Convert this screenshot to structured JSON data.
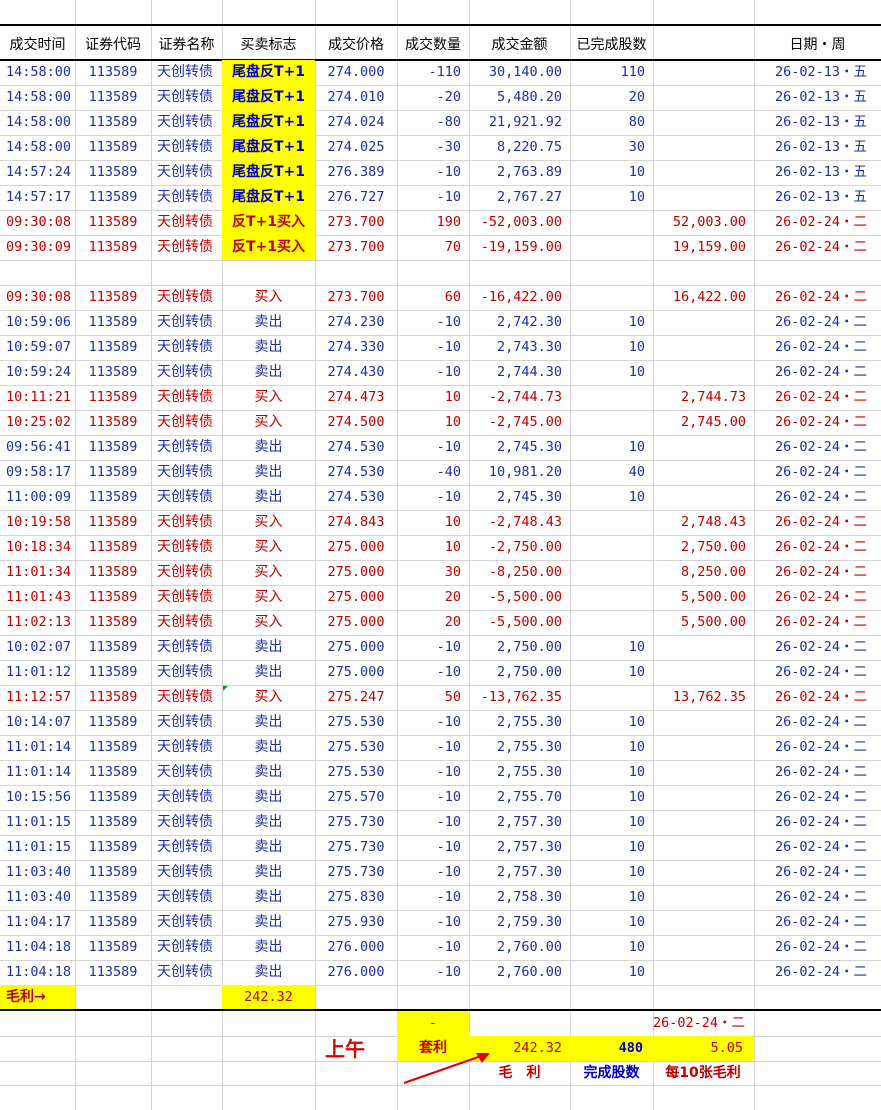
{
  "headers": [
    "成交时间",
    "证券代码",
    "证券名称",
    "买卖标志",
    "成交价格",
    "成交数量",
    "成交金额",
    "已完成股数",
    "",
    "日期・周"
  ],
  "rows": [
    {
      "time": "14:58:00",
      "code": "113589",
      "name": "天创转债",
      "flag": "尾盘反T+1",
      "price": "274.000",
      "qty": "-110",
      "amount": "30,140.00",
      "done": "110",
      "buy": "",
      "date": "26-02-13・五",
      "side": "sell",
      "hl": true
    },
    {
      "time": "14:58:00",
      "code": "113589",
      "name": "天创转债",
      "flag": "尾盘反T+1",
      "price": "274.010",
      "qty": "-20",
      "amount": "5,480.20",
      "done": "20",
      "buy": "",
      "date": "26-02-13・五",
      "side": "sell",
      "hl": true
    },
    {
      "time": "14:58:00",
      "code": "113589",
      "name": "天创转债",
      "flag": "尾盘反T+1",
      "price": "274.024",
      "qty": "-80",
      "amount": "21,921.92",
      "done": "80",
      "buy": "",
      "date": "26-02-13・五",
      "side": "sell",
      "hl": true
    },
    {
      "time": "14:58:00",
      "code": "113589",
      "name": "天创转债",
      "flag": "尾盘反T+1",
      "price": "274.025",
      "qty": "-30",
      "amount": "8,220.75",
      "done": "30",
      "buy": "",
      "date": "26-02-13・五",
      "side": "sell",
      "hl": true
    },
    {
      "time": "14:57:24",
      "code": "113589",
      "name": "天创转债",
      "flag": "尾盘反T+1",
      "price": "276.389",
      "qty": "-10",
      "amount": "2,763.89",
      "done": "10",
      "buy": "",
      "date": "26-02-13・五",
      "side": "sell",
      "hl": true
    },
    {
      "time": "14:57:17",
      "code": "113589",
      "name": "天创转债",
      "flag": "尾盘反T+1",
      "price": "276.727",
      "qty": "-10",
      "amount": "2,767.27",
      "done": "10",
      "buy": "",
      "date": "26-02-13・五",
      "side": "sell",
      "hl": true
    },
    {
      "time": "09:30:08",
      "code": "113589",
      "name": "天创转债",
      "flag": "反T+1买入",
      "price": "273.700",
      "qty": "190",
      "amount": "-52,003.00",
      "done": "",
      "buy": "52,003.00",
      "date": "26-02-24・二",
      "side": "buy",
      "hl": true
    },
    {
      "time": "09:30:09",
      "code": "113589",
      "name": "天创转债",
      "flag": "反T+1买入",
      "price": "273.700",
      "qty": "70",
      "amount": "-19,159.00",
      "done": "",
      "buy": "19,159.00",
      "date": "26-02-24・二",
      "side": "buy",
      "hl": true
    },
    {
      "blank": true
    },
    {
      "time": "09:30:08",
      "code": "113589",
      "name": "天创转债",
      "flag": "买入",
      "price": "273.700",
      "qty": "60",
      "amount": "-16,422.00",
      "done": "",
      "buy": "16,422.00",
      "date": "26-02-24・二",
      "side": "buy"
    },
    {
      "time": "10:59:06",
      "code": "113589",
      "name": "天创转债",
      "flag": "卖出",
      "price": "274.230",
      "qty": "-10",
      "amount": "2,742.30",
      "done": "10",
      "buy": "",
      "date": "26-02-24・二",
      "side": "sell"
    },
    {
      "time": "10:59:07",
      "code": "113589",
      "name": "天创转债",
      "flag": "卖出",
      "price": "274.330",
      "qty": "-10",
      "amount": "2,743.30",
      "done": "10",
      "buy": "",
      "date": "26-02-24・二",
      "side": "sell"
    },
    {
      "time": "10:59:24",
      "code": "113589",
      "name": "天创转债",
      "flag": "卖出",
      "price": "274.430",
      "qty": "-10",
      "amount": "2,744.30",
      "done": "10",
      "buy": "",
      "date": "26-02-24・二",
      "side": "sell"
    },
    {
      "time": "10:11:21",
      "code": "113589",
      "name": "天创转债",
      "flag": "买入",
      "price": "274.473",
      "qty": "10",
      "amount": "-2,744.73",
      "done": "",
      "buy": "2,744.73",
      "date": "26-02-24・二",
      "side": "buy"
    },
    {
      "time": "10:25:02",
      "code": "113589",
      "name": "天创转债",
      "flag": "买入",
      "price": "274.500",
      "qty": "10",
      "amount": "-2,745.00",
      "done": "",
      "buy": "2,745.00",
      "date": "26-02-24・二",
      "side": "buy"
    },
    {
      "time": "09:56:41",
      "code": "113589",
      "name": "天创转债",
      "flag": "卖出",
      "price": "274.530",
      "qty": "-10",
      "amount": "2,745.30",
      "done": "10",
      "buy": "",
      "date": "26-02-24・二",
      "side": "sell"
    },
    {
      "time": "09:58:17",
      "code": "113589",
      "name": "天创转债",
      "flag": "卖出",
      "price": "274.530",
      "qty": "-40",
      "amount": "10,981.20",
      "done": "40",
      "buy": "",
      "date": "26-02-24・二",
      "side": "sell"
    },
    {
      "time": "11:00:09",
      "code": "113589",
      "name": "天创转债",
      "flag": "卖出",
      "price": "274.530",
      "qty": "-10",
      "amount": "2,745.30",
      "done": "10",
      "buy": "",
      "date": "26-02-24・二",
      "side": "sell"
    },
    {
      "time": "10:19:58",
      "code": "113589",
      "name": "天创转债",
      "flag": "买入",
      "price": "274.843",
      "qty": "10",
      "amount": "-2,748.43",
      "done": "",
      "buy": "2,748.43",
      "date": "26-02-24・二",
      "side": "buy"
    },
    {
      "time": "10:18:34",
      "code": "113589",
      "name": "天创转债",
      "flag": "买入",
      "price": "275.000",
      "qty": "10",
      "amount": "-2,750.00",
      "done": "",
      "buy": "2,750.00",
      "date": "26-02-24・二",
      "side": "buy"
    },
    {
      "time": "11:01:34",
      "code": "113589",
      "name": "天创转债",
      "flag": "买入",
      "price": "275.000",
      "qty": "30",
      "amount": "-8,250.00",
      "done": "",
      "buy": "8,250.00",
      "date": "26-02-24・二",
      "side": "buy"
    },
    {
      "time": "11:01:43",
      "code": "113589",
      "name": "天创转债",
      "flag": "买入",
      "price": "275.000",
      "qty": "20",
      "amount": "-5,500.00",
      "done": "",
      "buy": "5,500.00",
      "date": "26-02-24・二",
      "side": "buy"
    },
    {
      "time": "11:02:13",
      "code": "113589",
      "name": "天创转债",
      "flag": "买入",
      "price": "275.000",
      "qty": "20",
      "amount": "-5,500.00",
      "done": "",
      "buy": "5,500.00",
      "date": "26-02-24・二",
      "side": "buy"
    },
    {
      "time": "10:02:07",
      "code": "113589",
      "name": "天创转债",
      "flag": "卖出",
      "price": "275.000",
      "qty": "-10",
      "amount": "2,750.00",
      "done": "10",
      "buy": "",
      "date": "26-02-24・二",
      "side": "sell"
    },
    {
      "time": "11:01:12",
      "code": "113589",
      "name": "天创转债",
      "flag": "卖出",
      "price": "275.000",
      "qty": "-10",
      "amount": "2,750.00",
      "done": "10",
      "buy": "",
      "date": "26-02-24・二",
      "side": "sell"
    },
    {
      "time": "11:12:57",
      "code": "113589",
      "name": "天创转债",
      "flag": "买入",
      "price": "275.247",
      "qty": "50",
      "amount": "-13,762.35",
      "done": "",
      "buy": "13,762.35",
      "date": "26-02-24・二",
      "side": "buy"
    },
    {
      "time": "10:14:07",
      "code": "113589",
      "name": "天创转债",
      "flag": "卖出",
      "price": "275.530",
      "qty": "-10",
      "amount": "2,755.30",
      "done": "10",
      "buy": "",
      "date": "26-02-24・二",
      "side": "sell"
    },
    {
      "time": "11:01:14",
      "code": "113589",
      "name": "天创转债",
      "flag": "卖出",
      "price": "275.530",
      "qty": "-10",
      "amount": "2,755.30",
      "done": "10",
      "buy": "",
      "date": "26-02-24・二",
      "side": "sell"
    },
    {
      "time": "11:01:14",
      "code": "113589",
      "name": "天创转债",
      "flag": "卖出",
      "price": "275.530",
      "qty": "-10",
      "amount": "2,755.30",
      "done": "10",
      "buy": "",
      "date": "26-02-24・二",
      "side": "sell"
    },
    {
      "time": "10:15:56",
      "code": "113589",
      "name": "天创转债",
      "flag": "卖出",
      "price": "275.570",
      "qty": "-10",
      "amount": "2,755.70",
      "done": "10",
      "buy": "",
      "date": "26-02-24・二",
      "side": "sell"
    },
    {
      "time": "11:01:15",
      "code": "113589",
      "name": "天创转债",
      "flag": "卖出",
      "price": "275.730",
      "qty": "-10",
      "amount": "2,757.30",
      "done": "10",
      "buy": "",
      "date": "26-02-24・二",
      "side": "sell"
    },
    {
      "time": "11:01:15",
      "code": "113589",
      "name": "天创转债",
      "flag": "卖出",
      "price": "275.730",
      "qty": "-10",
      "amount": "2,757.30",
      "done": "10",
      "buy": "",
      "date": "26-02-24・二",
      "side": "sell"
    },
    {
      "time": "11:03:40",
      "code": "113589",
      "name": "天创转债",
      "flag": "卖出",
      "price": "275.730",
      "qty": "-10",
      "amount": "2,757.30",
      "done": "10",
      "buy": "",
      "date": "26-02-24・二",
      "side": "sell"
    },
    {
      "time": "11:03:40",
      "code": "113589",
      "name": "天创转债",
      "flag": "卖出",
      "price": "275.830",
      "qty": "-10",
      "amount": "2,758.30",
      "done": "10",
      "buy": "",
      "date": "26-02-24・二",
      "side": "sell"
    },
    {
      "time": "11:04:17",
      "code": "113589",
      "name": "天创转债",
      "flag": "卖出",
      "price": "275.930",
      "qty": "-10",
      "amount": "2,759.30",
      "done": "10",
      "buy": "",
      "date": "26-02-24・二",
      "side": "sell"
    },
    {
      "time": "11:04:18",
      "code": "113589",
      "name": "天创转债",
      "flag": "卖出",
      "price": "276.000",
      "qty": "-10",
      "amount": "2,760.00",
      "done": "10",
      "buy": "",
      "date": "26-02-24・二",
      "side": "sell"
    },
    {
      "time": "11:04:18",
      "code": "113589",
      "name": "天创转债",
      "flag": "卖出",
      "price": "276.000",
      "qty": "-10",
      "amount": "2,760.00",
      "done": "10",
      "buy": "",
      "date": "26-02-24・二",
      "side": "sell"
    }
  ],
  "gross": {
    "label": "毛利→",
    "value": "242.32"
  },
  "summary": {
    "dash": "-",
    "date": "26-02-24・二",
    "morning": "上午",
    "arb_label": "套利",
    "arb_value": "242.32",
    "shares_value": "480",
    "per10_value": "5.05",
    "gross_caption": "毛　利",
    "shares_caption": "完成股数",
    "per10_caption": "每10张毛利"
  },
  "colors": {
    "sell": "#1f2fa0",
    "buy": "#c00000",
    "highlight": "#ffff00",
    "accent": "#e00000"
  }
}
